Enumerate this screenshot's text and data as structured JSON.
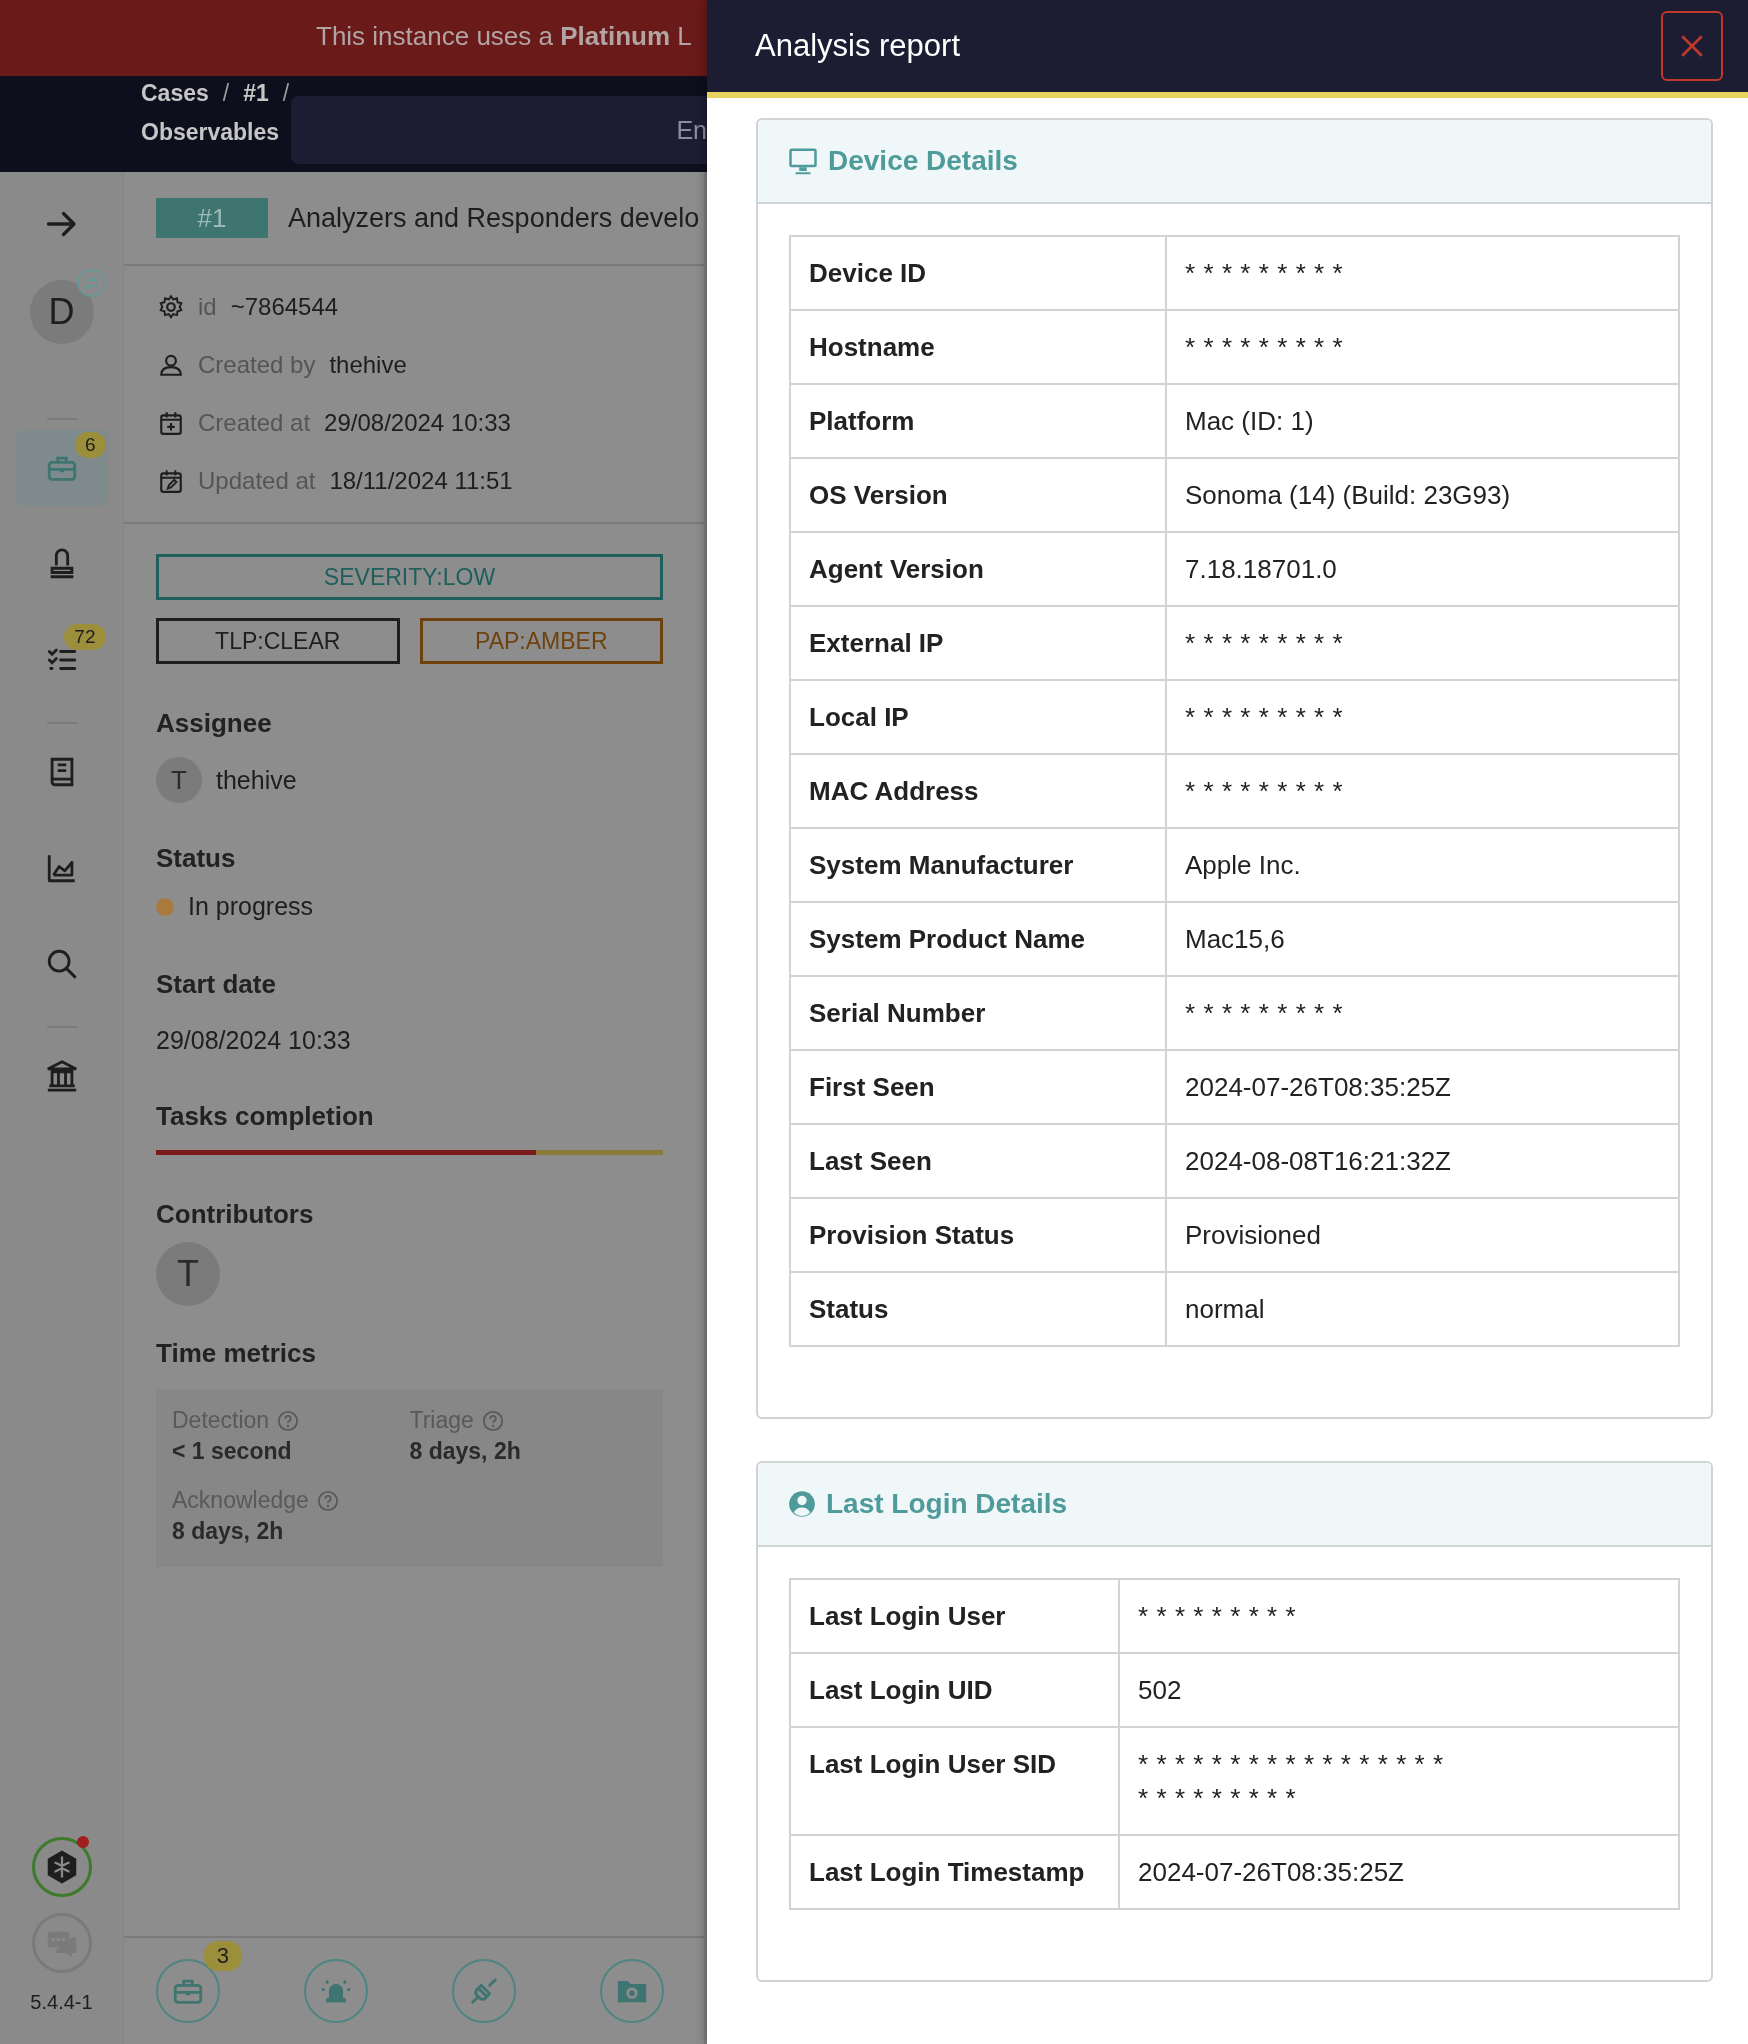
{
  "banner": {
    "text": "This instance uses a **Platinum** L"
  },
  "breadcrumb": [
    {
      "kind": "link",
      "text": "Cases"
    },
    {
      "kind": "sep",
      "text": "/"
    },
    {
      "kind": "link",
      "text": "#1"
    },
    {
      "kind": "sep",
      "text": "/"
    },
    {
      "kind": "link",
      "text": "Observables"
    }
  ],
  "search_bar": {
    "text": "En"
  },
  "sidebar": {
    "avatar": {
      "initial": "D"
    },
    "items": [
      {
        "kind": "cases",
        "badge": "6",
        "selected": true
      },
      {
        "kind": "alerts",
        "selected": false
      },
      {
        "kind": "tasks",
        "badge": "72",
        "selected": false
      },
      {
        "kind": "knowledge",
        "selected": false
      },
      {
        "kind": "dashboards",
        "selected": false
      },
      {
        "kind": "search",
        "selected": false
      },
      {
        "kind": "organisation",
        "selected": false
      }
    ],
    "assistant": {
      "notification": true
    },
    "version": "5.4.4-1"
  },
  "case": {
    "number": "#1",
    "title": "Analyzers and Responders develo",
    "details": [
      {
        "kind": "id",
        "label": "id",
        "value": "~7864544"
      },
      {
        "kind": "user",
        "label": "Created by",
        "value": "thehive"
      },
      {
        "kind": "created",
        "label": "Created at",
        "value": "29/08/2024 10:33"
      },
      {
        "kind": "updated",
        "label": "Updated at",
        "value": "18/11/2024 11:51"
      }
    ],
    "tags": [
      {
        "kind": "severity",
        "text": "SEVERITY:LOW",
        "color": "#1f5f5b"
      },
      {
        "kind": "tlp",
        "text": "TLP:CLEAR",
        "color": "#1e1e1e"
      },
      {
        "kind": "pap",
        "text": "PAP:AMBER",
        "color": "#6e420c"
      }
    ],
    "assignee": {
      "heading": "Assignee",
      "initial": "T",
      "name": "thehive"
    },
    "status": {
      "heading": "Status",
      "text": "In progress",
      "color": "#a87a3c"
    },
    "start_date": {
      "heading": "Start date",
      "value": "29/08/2024 10:33"
    },
    "tasks_completion": {
      "heading": "Tasks completion",
      "level": 0.75
    },
    "contributors": {
      "heading": "Contributors",
      "initials": [
        "T"
      ]
    },
    "time_metrics": {
      "heading": "Time metrics",
      "items": [
        {
          "label": "Detection",
          "value": "< 1 second"
        },
        {
          "label": "Triage",
          "value": "8 days, 2h"
        },
        {
          "label": "Acknowledge",
          "value": "8 days, 2h"
        }
      ]
    }
  },
  "bottom_bar": [
    {
      "kind": "cases",
      "badge": "3"
    },
    {
      "kind": "alerts"
    },
    {
      "kind": "integrations"
    },
    {
      "kind": "files"
    }
  ],
  "drawer": {
    "title": "Analysis report",
    "sections": [
      {
        "kind": "device",
        "title": "Device Details",
        "rows": [
          {
            "label": "Device ID",
            "value": "*********"
          },
          {
            "label": "Hostname",
            "value": "*********"
          },
          {
            "label": "Platform",
            "value": "Mac (ID: 1)"
          },
          {
            "label": "OS Version",
            "value": "Sonoma (14) (Build: 23G93)"
          },
          {
            "label": "Agent Version",
            "value": "7.18.18701.0"
          },
          {
            "label": "External IP",
            "value": "*********"
          },
          {
            "label": "Local IP",
            "value": "*********"
          },
          {
            "label": "MAC Address",
            "value": "*********"
          },
          {
            "label": "System Manufacturer",
            "value": "Apple Inc."
          },
          {
            "label": "System Product Name",
            "value": "Mac15,6"
          },
          {
            "label": "Serial Number",
            "value": "*********"
          },
          {
            "label": "First Seen",
            "value": "2024-07-26T08:35:25Z"
          },
          {
            "label": "Last Seen",
            "value": "2024-08-08T16:21:32Z"
          },
          {
            "label": "Provision Status",
            "value": "Provisioned"
          },
          {
            "label": "Status",
            "value": "normal"
          }
        ]
      },
      {
        "kind": "login",
        "title": "Last Login Details",
        "rows": [
          {
            "label": "Last Login User",
            "value": "*********"
          },
          {
            "label": "Last Login UID",
            "value": "502"
          },
          {
            "label": "Last Login User SID",
            "value": "*****************\n*********"
          },
          {
            "label": "Last Login Timestamp",
            "value": "2024-07-26T08:35:25Z"
          }
        ]
      }
    ]
  }
}
